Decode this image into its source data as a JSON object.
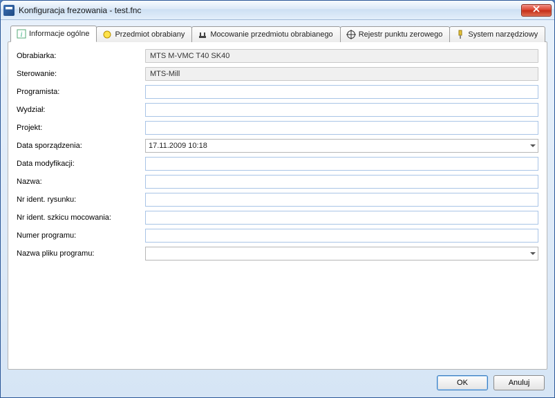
{
  "window": {
    "title": "Konfiguracja frezowania - test.fnc"
  },
  "tabs": [
    {
      "label": "Informacje ogólne",
      "icon": "info"
    },
    {
      "label": "Przedmiot obrabiany",
      "icon": "circle"
    },
    {
      "label": "Mocowanie przedmiotu obrabianego",
      "icon": "clamp"
    },
    {
      "label": "Rejestr punktu zerowego",
      "icon": "target"
    },
    {
      "label": "System narzędziowy",
      "icon": "tool"
    }
  ],
  "fields": {
    "machine": {
      "label": "Obrabiarka:",
      "value": "MTS M-VMC T40 SK40",
      "type": "readonly"
    },
    "control": {
      "label": "Sterowanie:",
      "value": "MTS-Mill",
      "type": "readonly"
    },
    "programmer": {
      "label": "Programista:",
      "value": "",
      "type": "text"
    },
    "department": {
      "label": "Wydział:",
      "value": "",
      "type": "text"
    },
    "project": {
      "label": "Projekt:",
      "value": "",
      "type": "text"
    },
    "created": {
      "label": "Data sporządzenia:",
      "value": "17.11.2009 10:18",
      "type": "combo"
    },
    "modified": {
      "label": "Data modyfikacji:",
      "value": "",
      "type": "text"
    },
    "name": {
      "label": "Nazwa:",
      "value": "",
      "type": "text"
    },
    "drawingId": {
      "label": "Nr ident. rysunku:",
      "value": "",
      "type": "text"
    },
    "fixtureId": {
      "label": "Nr ident. szkicu mocowania:",
      "value": "",
      "type": "text"
    },
    "programNo": {
      "label": "Numer programu:",
      "value": "",
      "type": "text"
    },
    "programFile": {
      "label": "Nazwa pliku programu:",
      "value": "",
      "type": "combo"
    }
  },
  "buttons": {
    "ok": "OK",
    "cancel": "Anuluj"
  }
}
